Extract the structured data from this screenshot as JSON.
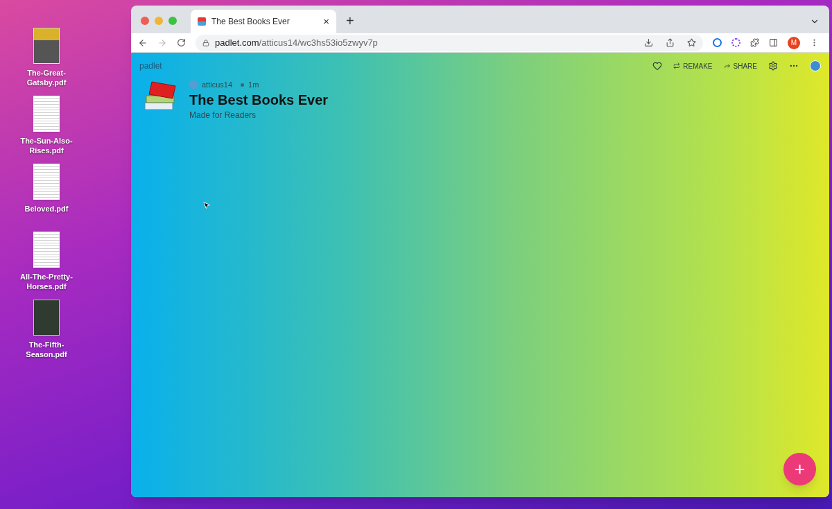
{
  "desktop_files": [
    {
      "name": "The-Great-Gatsby.pdf",
      "kind": "cover"
    },
    {
      "name": "The-Sun-Also-Rises.pdf",
      "kind": "text"
    },
    {
      "name": "Beloved.pdf",
      "kind": "text"
    },
    {
      "name": "All-The-Pretty-Horses.pdf",
      "kind": "text"
    },
    {
      "name": "The-Fifth-Season.pdf",
      "kind": "photo"
    }
  ],
  "browser": {
    "tab": {
      "title": "The Best Books Ever",
      "close": "×"
    },
    "new_tab": "+",
    "url_host": "padlet.com",
    "url_path": "/atticus14/wc3hs53io5zwyv7p",
    "profile": "M"
  },
  "padlet": {
    "brand": "padlet",
    "actions": [
      "REMAKE",
      "SHARE"
    ],
    "author": "atticus14",
    "age": "1m",
    "title": "The Best Books Ever",
    "subtitle": "Made for Readers",
    "add_button": "+"
  }
}
